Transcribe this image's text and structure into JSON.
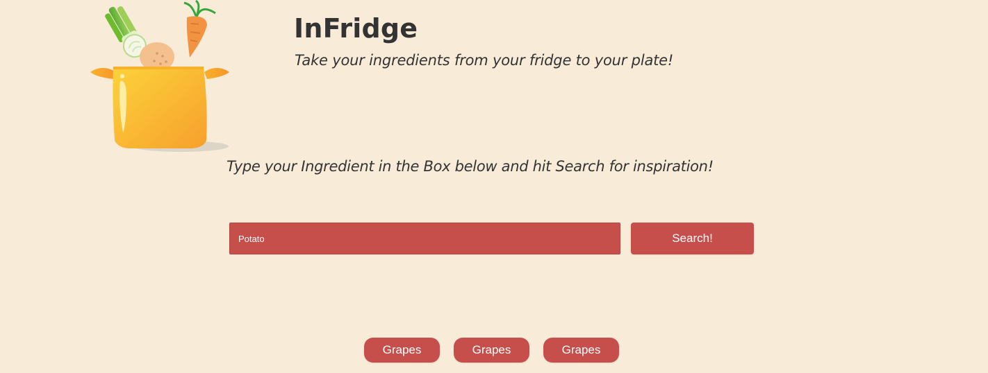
{
  "header": {
    "title": "InFridge",
    "tagline": "Take your ingredients from your fridge to your plate!"
  },
  "logo": {
    "icon": "cooking-pot-with-vegetables-icon",
    "colors": {
      "pot": "#fbb52f",
      "leek": "#8fca43",
      "carrot": "#f59a45",
      "potato": "#f2c08d"
    }
  },
  "instruction": {
    "text": "Type your Ingredient in the Box below and hit Search for inspiration!"
  },
  "search": {
    "value": "Potato",
    "placeholder": "",
    "button_label": "Search!"
  },
  "suggestions": [
    {
      "label": "Grapes"
    },
    {
      "label": "Grapes"
    },
    {
      "label": "Grapes"
    }
  ],
  "colors": {
    "background": "#f8ebd8",
    "accent": "#c64f4c",
    "text": "#333333"
  }
}
